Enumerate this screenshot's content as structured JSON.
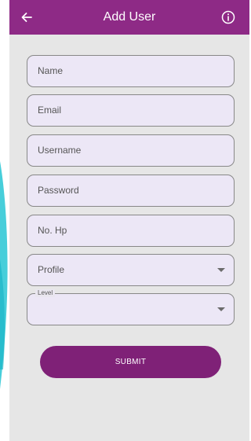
{
  "appbar": {
    "title": "Add User",
    "back_icon": "arrow-left-icon",
    "info_icon": "info-circle-icon"
  },
  "form": {
    "name_placeholder": "Name",
    "email_placeholder": "Email",
    "username_placeholder": "Username",
    "password_placeholder": "Password",
    "phone_placeholder": "No. Hp",
    "profile_label": "Profile",
    "level_label": "Level",
    "level_value": ""
  },
  "submit_label": "SUBMIT",
  "colors": {
    "appbar": "#8e2a86",
    "submit": "#7f2177",
    "field_bg": "#ece7f6",
    "screen_bg": "#e6e6e6",
    "decor": "#27c6d4"
  }
}
